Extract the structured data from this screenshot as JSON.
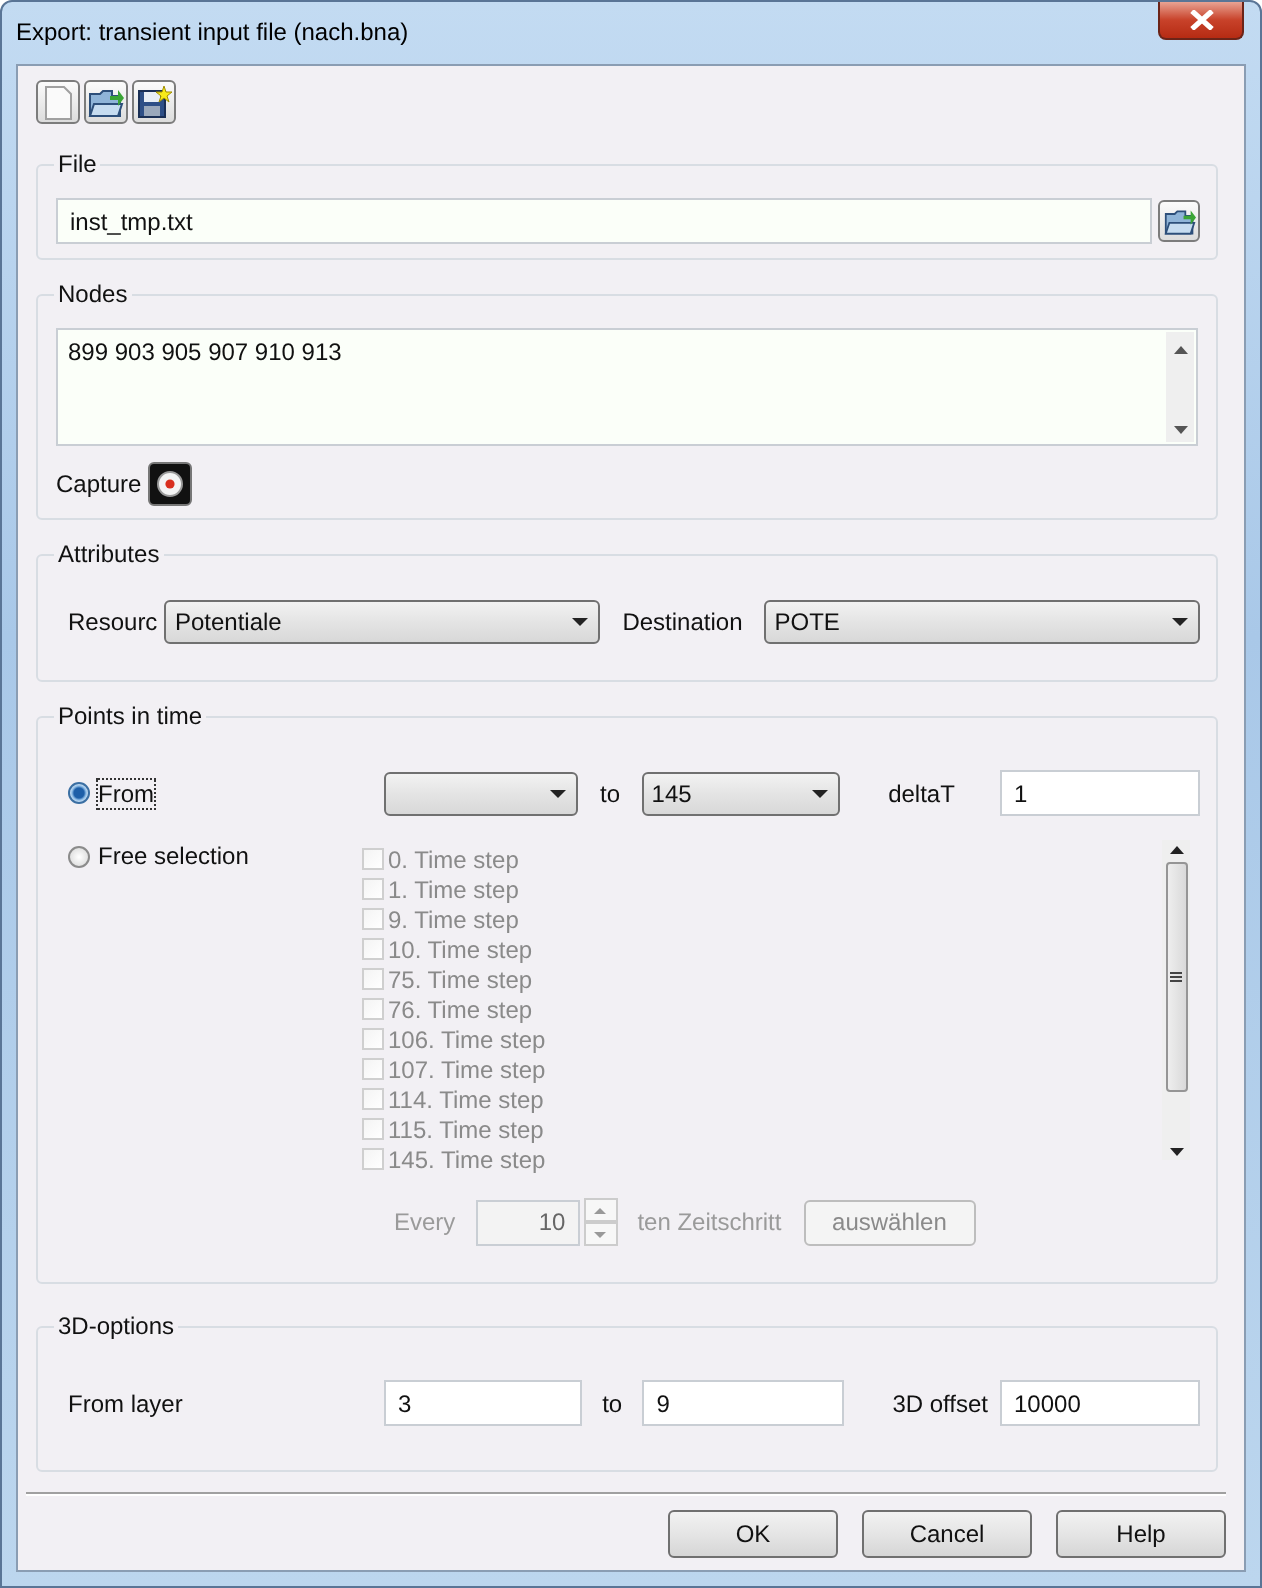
{
  "window": {
    "title": "Export: transient input file (nach.bna)"
  },
  "file": {
    "title": "File",
    "value": "inst_tmp.txt"
  },
  "nodes": {
    "title": "Nodes",
    "value": "899 903 905 907 910 913",
    "capture_label": "Capture"
  },
  "attributes": {
    "title": "Attributes",
    "source_label": "Resourc",
    "source_value": "Potentiale",
    "destination_label": "Destination",
    "destination_value": "POTE"
  },
  "points_in_time": {
    "title": "Points in time",
    "modes": [
      {
        "label": "From",
        "selected": true
      },
      {
        "label": "Free selection",
        "selected": false
      }
    ],
    "to_label": "to",
    "to_value": "145",
    "delta_label": "deltaT",
    "delta_value": "1",
    "time_steps": [
      {
        "label": "0. Time step",
        "checked": false,
        "disabled": true
      },
      {
        "label": "1. Time step",
        "checked": false,
        "disabled": true
      },
      {
        "label": "9. Time step",
        "checked": false,
        "disabled": true
      },
      {
        "label": "10. Time step",
        "checked": false,
        "disabled": true
      },
      {
        "label": "75. Time step",
        "checked": false,
        "disabled": true
      },
      {
        "label": "76. Time step",
        "checked": false,
        "disabled": true
      },
      {
        "label": "106. Time step",
        "checked": false,
        "disabled": true
      },
      {
        "label": "107. Time step",
        "checked": false,
        "disabled": true
      },
      {
        "label": "114. Time step",
        "checked": false,
        "disabled": true
      },
      {
        "label": "115. Time step",
        "checked": false,
        "disabled": true
      },
      {
        "label": "145. Time step",
        "checked": false,
        "disabled": true
      }
    ],
    "every": {
      "label": "Every",
      "value": "10",
      "suffix": "ten Zeitschritt",
      "button": "auswählen",
      "disabled": true
    }
  },
  "options_3d": {
    "title": "3D-options",
    "from_label": "From layer",
    "from_value": "3",
    "to_label": "to",
    "to_value": "9",
    "offset_label": "3D offset",
    "offset_value": "10000"
  },
  "buttons": [
    "OK",
    "Cancel",
    "Help"
  ]
}
